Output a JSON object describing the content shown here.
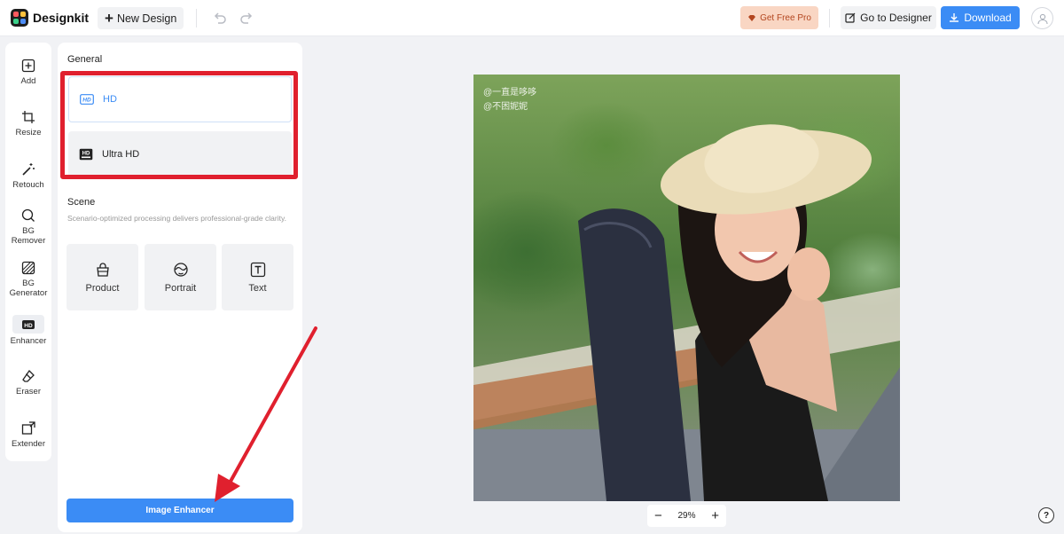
{
  "app": {
    "name": "Designkit"
  },
  "header": {
    "new_design": "New Design",
    "get_pro": "Get Free Pro",
    "go_designer": "Go to Designer",
    "download": "Download"
  },
  "rail": {
    "items": [
      {
        "label": "Add",
        "icon": "plus-square-icon"
      },
      {
        "label": "Resize",
        "icon": "crop-icon"
      },
      {
        "label": "Retouch",
        "icon": "magic-wand-icon"
      },
      {
        "label": "BG Remover",
        "icon": "bg-remover-icon"
      },
      {
        "label": "BG Generator",
        "icon": "bg-generator-icon"
      },
      {
        "label": "Enhancer",
        "icon": "hd-icon",
        "active": true
      },
      {
        "label": "Eraser",
        "icon": "eraser-icon"
      },
      {
        "label": "Extender",
        "icon": "extender-icon"
      }
    ]
  },
  "panel": {
    "general_title": "General",
    "options": [
      {
        "label": "HD",
        "icon": "hd-icon",
        "selected": true
      },
      {
        "label": "Ultra HD",
        "icon": "ultra-hd-icon",
        "selected": false
      }
    ],
    "scene_title": "Scene",
    "scene_desc": "Scenario-optimized processing delivers professional-grade clarity.",
    "scenes": [
      {
        "label": "Product",
        "icon": "bag-icon"
      },
      {
        "label": "Portrait",
        "icon": "face-icon"
      },
      {
        "label": "Text",
        "icon": "text-icon"
      }
    ],
    "enhance_button": "Image Enhancer"
  },
  "canvas": {
    "watermark_1": "@一直是哆哆",
    "watermark_2": "@不困妮妮",
    "zoom": "29%",
    "zoom_minus": "−",
    "zoom_plus": "+"
  },
  "help": "?",
  "colors": {
    "accent": "#3b8cf5",
    "highlight": "#e0202e",
    "pro_bg": "#f9d6c3"
  }
}
